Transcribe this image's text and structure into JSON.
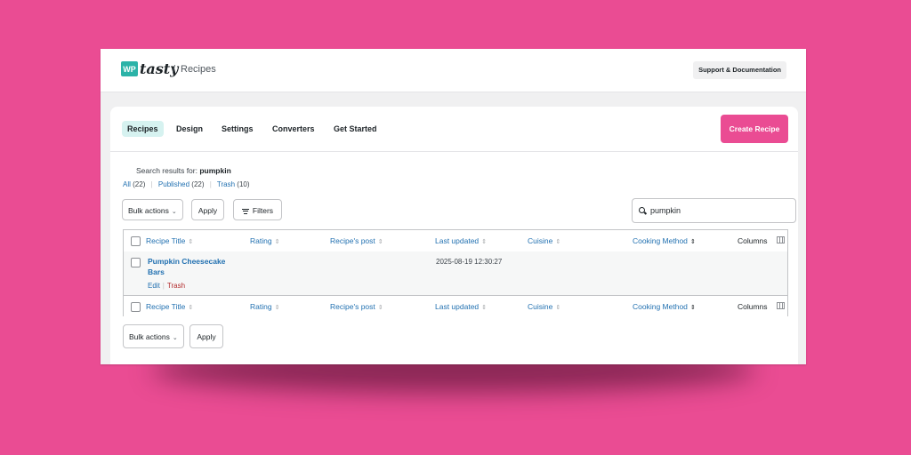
{
  "header": {
    "logo_badge": "WP",
    "logo_word": "tasty",
    "breadcrumb_sep": "/",
    "breadcrumb": "Recipes",
    "support_label": "Support & Documentation"
  },
  "tabs": [
    "Recipes",
    "Design",
    "Settings",
    "Converters",
    "Get Started"
  ],
  "create_label": "Create Recipe",
  "search": {
    "results_prefix": "Search results for:",
    "query": "pumpkin",
    "value": "pumpkin"
  },
  "views": {
    "all_label": "All",
    "all_count": "(22)",
    "published_label": "Published",
    "published_count": "(22)",
    "trash_label": "Trash",
    "trash_count": "(10)"
  },
  "bulk": {
    "label": "Bulk actions",
    "apply": "Apply",
    "filters": "Filters"
  },
  "columns": [
    "Recipe Title",
    "Rating",
    "Recipe's post",
    "Last updated",
    "Cuisine",
    "Cooking Method",
    "Columns"
  ],
  "rows": [
    {
      "title": "Pumpkin Cheesecake Bars",
      "edit": "Edit",
      "trash": "Trash",
      "last_updated": "2025-08-19 12:30:27"
    }
  ],
  "colors": {
    "background": "#ea4c93",
    "accent": "#2bb3a8",
    "link": "#2271b1",
    "danger": "#b32d2e"
  }
}
